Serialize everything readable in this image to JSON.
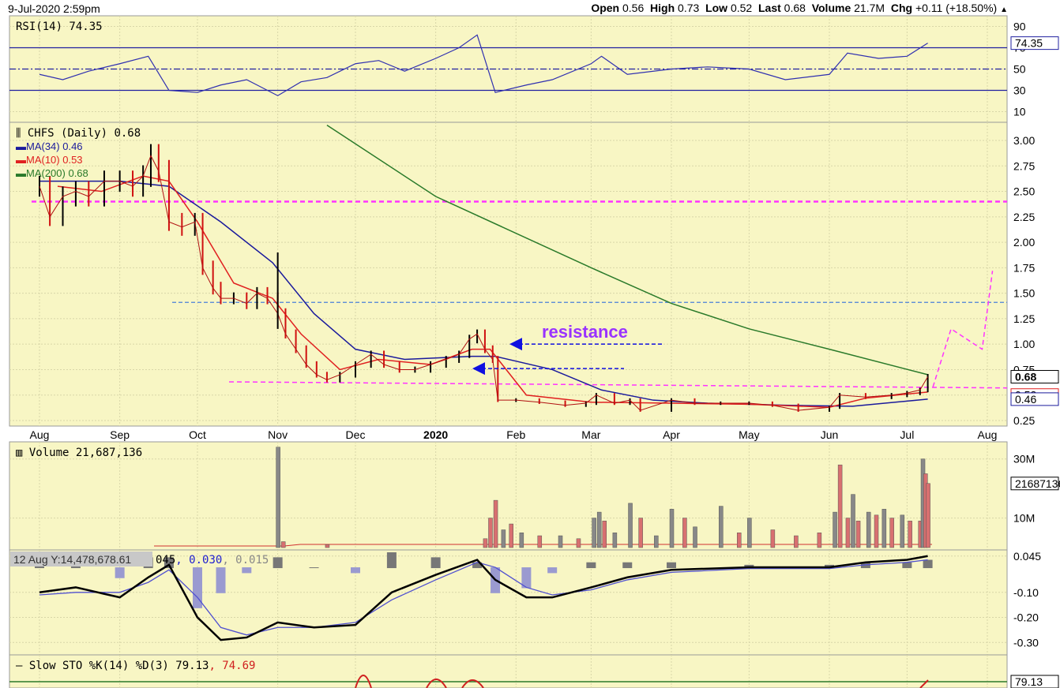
{
  "header": {
    "datetime": "9-Jul-2020 2:59pm",
    "open_label": "Open",
    "open": "0.56",
    "high_label": "High",
    "high": "0.73",
    "low_label": "Low",
    "low": "0.52",
    "last_label": "Last",
    "last": "0.68",
    "volume_label": "Volume",
    "volume": "21.7M",
    "chg_label": "Chg",
    "chg": "+0.11 (+18.50%)",
    "up_icon": "triangle-up-icon"
  },
  "colors": {
    "panel": "#f8f6c4",
    "ma34": "#1a1a9c",
    "ma10": "#e02020",
    "ma200": "#2a7a2a",
    "annot": "#ff33ff",
    "blue_dash": "#4a7fd8",
    "arrow": "#1010e0"
  },
  "chart_data": [
    {
      "type": "line",
      "title": "RSI(14) 74.35",
      "ylim": [
        0,
        100
      ],
      "ticks": [
        "90",
        "70",
        "50",
        "30",
        "10"
      ],
      "tick_values": [
        90,
        70,
        50,
        30,
        10
      ],
      "last_label": "74.35",
      "levels": [
        70,
        50,
        30
      ],
      "x": [
        "2019-08-01",
        "2019-08-10",
        "2019-08-20",
        "2019-09-01",
        "2019-09-12",
        "2019-09-20",
        "2019-10-01",
        "2019-10-10",
        "2019-10-20",
        "2019-11-01",
        "2019-11-10",
        "2019-11-20",
        "2019-12-01",
        "2019-12-10",
        "2019-12-20",
        "2020-01-01",
        "2020-01-10",
        "2020-01-17",
        "2020-01-24",
        "2020-02-05",
        "2020-02-15",
        "2020-03-01",
        "2020-03-05",
        "2020-03-15",
        "2020-04-01",
        "2020-04-15",
        "2020-05-01",
        "2020-05-15",
        "2020-06-01",
        "2020-06-08",
        "2020-06-20",
        "2020-07-01",
        "2020-07-09"
      ],
      "values": [
        45,
        40,
        48,
        55,
        62,
        30,
        28,
        35,
        40,
        25,
        38,
        42,
        55,
        58,
        48,
        60,
        70,
        82,
        28,
        35,
        40,
        55,
        62,
        45,
        50,
        52,
        50,
        40,
        45,
        65,
        60,
        62,
        74.35
      ]
    },
    {
      "type": "ohlc-line",
      "title": "CHFS (Daily) 0.68",
      "ylim": [
        0.25,
        3.0
      ],
      "ticks": [
        "3.00",
        "2.75",
        "2.50",
        "2.25",
        "2.00",
        "1.75",
        "1.50",
        "1.25",
        "1.00",
        "0.75",
        "0.50",
        "0.25"
      ],
      "tick_values": [
        3,
        2.75,
        2.5,
        2.25,
        2,
        1.75,
        1.5,
        1.25,
        1,
        0.75,
        0.5,
        0.25
      ],
      "xticks": [
        "Aug",
        "Sep",
        "Oct",
        "Nov",
        "Dec",
        "2020",
        "Feb",
        "Mar",
        "Apr",
        "May",
        "Jun",
        "Jul",
        "Aug"
      ],
      "xtick_dates": [
        "2019-08-01",
        "2019-09-01",
        "2019-10-01",
        "2019-11-01",
        "2019-12-01",
        "2020-01-01",
        "2020-02-01",
        "2020-03-01",
        "2020-04-01",
        "2020-05-01",
        "2020-06-01",
        "2020-07-01",
        "2020-08-01"
      ],
      "last_labels": {
        "last": "0.68",
        "ma10": "0.53",
        "ma34": "0.46"
      },
      "legend": [
        {
          "name": "MA(34) 0.46",
          "color": "#1a1a9c"
        },
        {
          "name": "MA(10) 0.53",
          "color": "#e02020"
        },
        {
          "name": "MA(200) 0.68",
          "color": "#2a7a2a"
        }
      ],
      "close": {
        "x": [
          "2019-08-01",
          "2019-08-05",
          "2019-08-10",
          "2019-08-15",
          "2019-08-20",
          "2019-08-26",
          "2019-09-01",
          "2019-09-06",
          "2019-09-10",
          "2019-09-13",
          "2019-09-16",
          "2019-09-20",
          "2019-09-25",
          "2019-09-30",
          "2019-10-03",
          "2019-10-07",
          "2019-10-10",
          "2019-10-15",
          "2019-10-20",
          "2019-10-24",
          "2019-10-28",
          "2019-11-01",
          "2019-11-04",
          "2019-11-08",
          "2019-11-12",
          "2019-11-16",
          "2019-11-20",
          "2019-11-25",
          "2019-12-01",
          "2019-12-07",
          "2019-12-12",
          "2019-12-18",
          "2019-12-24",
          "2019-12-30",
          "2020-01-05",
          "2020-01-10",
          "2020-01-14",
          "2020-01-17",
          "2020-01-20",
          "2020-01-23",
          "2020-01-25",
          "2020-02-01",
          "2020-02-10",
          "2020-02-20",
          "2020-02-28",
          "2020-03-03",
          "2020-03-10",
          "2020-03-16",
          "2020-03-20",
          "2020-04-01",
          "2020-04-10",
          "2020-04-20",
          "2020-05-01",
          "2020-05-10",
          "2020-05-20",
          "2020-06-01",
          "2020-06-05",
          "2020-06-15",
          "2020-06-25",
          "2020-07-01",
          "2020-07-06",
          "2020-07-09"
        ],
        "values": [
          2.55,
          2.25,
          2.45,
          2.5,
          2.45,
          2.6,
          2.6,
          2.55,
          2.65,
          2.85,
          2.7,
          2.2,
          2.15,
          2.2,
          1.75,
          1.55,
          1.45,
          1.45,
          1.4,
          1.5,
          1.45,
          1.3,
          1.1,
          0.95,
          0.8,
          0.7,
          0.65,
          0.7,
          0.8,
          0.9,
          0.8,
          0.75,
          0.75,
          0.8,
          0.85,
          0.9,
          1.05,
          1.1,
          0.95,
          0.85,
          0.45,
          0.45,
          0.43,
          0.4,
          0.42,
          0.5,
          0.42,
          0.45,
          0.35,
          0.45,
          0.42,
          0.42,
          0.42,
          0.4,
          0.35,
          0.38,
          0.5,
          0.48,
          0.5,
          0.52,
          0.55,
          0.68
        ]
      },
      "ma34": {
        "x": [
          "2019-08-01",
          "2019-09-01",
          "2019-09-20",
          "2019-10-10",
          "2019-10-30",
          "2019-11-15",
          "2019-12-01",
          "2019-12-20",
          "2020-01-15",
          "2020-01-24",
          "2020-02-15",
          "2020-03-05",
          "2020-03-25",
          "2020-04-15",
          "2020-05-15",
          "2020-06-10",
          "2020-07-09"
        ],
        "values": [
          2.6,
          2.6,
          2.55,
          2.2,
          1.8,
          1.3,
          0.95,
          0.85,
          0.88,
          0.88,
          0.75,
          0.55,
          0.45,
          0.42,
          0.4,
          0.39,
          0.46
        ]
      },
      "ma10": {
        "x": [
          "2019-08-08",
          "2019-08-25",
          "2019-09-10",
          "2019-09-20",
          "2019-10-01",
          "2019-10-15",
          "2019-10-30",
          "2019-11-10",
          "2019-11-25",
          "2019-12-10",
          "2019-12-30",
          "2020-01-15",
          "2020-01-22",
          "2020-02-05",
          "2020-03-01",
          "2020-04-01",
          "2020-05-01",
          "2020-06-01",
          "2020-06-15",
          "2020-07-09"
        ],
        "values": [
          2.55,
          2.5,
          2.65,
          2.6,
          2.2,
          1.6,
          1.45,
          1.1,
          0.75,
          0.85,
          0.8,
          0.95,
          0.95,
          0.5,
          0.43,
          0.42,
          0.41,
          0.38,
          0.47,
          0.53
        ]
      },
      "ma200": {
        "x": [
          "2019-11-20",
          "2020-01-01",
          "2020-03-01",
          "2020-04-01",
          "2020-05-01",
          "2020-06-01",
          "2020-07-09"
        ],
        "values": [
          3.15,
          2.45,
          1.75,
          1.4,
          1.15,
          0.95,
          0.7
        ]
      },
      "annotations": {
        "resistance_text": "resistance",
        "magenta_upper": 2.4,
        "magenta_lower": [
          0.63,
          0.57
        ],
        "blue_dash": 1.41,
        "arrow1_level": 1.0,
        "arrow2_level": 0.76,
        "projection": {
          "x": [
            "2020-07-11",
            "2020-07-18",
            "2020-07-30",
            "2020-08-03"
          ],
          "values": [
            0.58,
            1.15,
            0.95,
            1.72
          ]
        }
      }
    },
    {
      "type": "bar",
      "title": "Volume 21,687,136",
      "ylim": [
        0,
        35
      ],
      "unit": "M",
      "ticks": [
        "30M",
        "10M"
      ],
      "tick_values": [
        30,
        10
      ],
      "last_label": "21687136",
      "x": [
        "2019-11-01",
        "2019-11-03",
        "2019-11-20",
        "2020-01-20",
        "2020-01-22",
        "2020-01-24",
        "2020-01-27",
        "2020-01-30",
        "2020-02-03",
        "2020-02-10",
        "2020-02-18",
        "2020-02-25",
        "2020-03-02",
        "2020-03-04",
        "2020-03-06",
        "2020-03-10",
        "2020-03-16",
        "2020-03-20",
        "2020-03-26",
        "2020-04-01",
        "2020-04-06",
        "2020-04-10",
        "2020-04-20",
        "2020-04-27",
        "2020-05-01",
        "2020-05-10",
        "2020-05-19",
        "2020-05-28",
        "2020-06-03",
        "2020-06-05",
        "2020-06-08",
        "2020-06-10",
        "2020-06-12",
        "2020-06-16",
        "2020-06-19",
        "2020-06-22",
        "2020-06-25",
        "2020-06-29",
        "2020-07-02",
        "2020-07-06",
        "2020-07-07",
        "2020-07-08",
        "2020-07-09"
      ],
      "values": [
        34,
        2,
        1,
        3,
        10,
        16,
        6,
        8,
        5,
        4,
        4,
        3,
        10,
        12,
        9,
        5,
        15,
        10,
        4,
        13,
        10,
        7,
        14,
        5,
        10,
        6,
        4,
        5,
        12,
        28,
        10,
        18,
        9,
        12,
        11,
        13,
        10,
        11,
        9,
        9,
        30,
        25,
        21.7
      ],
      "up": [
        false,
        true,
        true,
        true,
        true,
        true,
        false,
        true,
        false,
        true,
        false,
        true,
        false,
        false,
        true,
        false,
        false,
        true,
        false,
        false,
        true,
        false,
        false,
        true,
        false,
        true,
        true,
        true,
        false,
        true,
        true,
        false,
        true,
        false,
        true,
        false,
        true,
        false,
        true,
        true,
        false,
        true,
        true
      ]
    },
    {
      "type": "line",
      "title": "MACD",
      "values_label_clipped": "045",
      "values_label_a": ", 0.030",
      "values_label_b": ", 0.015",
      "tooltip": "12 Aug Y:14,478,678.61",
      "ylim": [
        -0.34,
        0.06
      ],
      "ticks": [
        "0.045",
        "-0.10",
        "-0.20",
        "-0.30"
      ],
      "tick_values": [
        0.045,
        -0.1,
        -0.2,
        -0.3
      ],
      "x": [
        "2019-08-01",
        "2019-08-15",
        "2019-09-01",
        "2019-09-12",
        "2019-09-20",
        "2019-10-01",
        "2019-10-10",
        "2019-10-20",
        "2019-11-01",
        "2019-11-15",
        "2019-12-01",
        "2019-12-15",
        "2020-01-01",
        "2020-01-17",
        "2020-01-24",
        "2020-02-05",
        "2020-02-15",
        "2020-03-01",
        "2020-03-15",
        "2020-04-01",
        "2020-05-01",
        "2020-06-01",
        "2020-06-15",
        "2020-07-01",
        "2020-07-09"
      ],
      "macd": [
        -0.1,
        -0.08,
        -0.12,
        -0.04,
        0.01,
        -0.2,
        -0.29,
        -0.28,
        -0.22,
        -0.24,
        -0.23,
        -0.1,
        -0.03,
        0.03,
        -0.05,
        -0.12,
        -0.12,
        -0.08,
        -0.04,
        -0.01,
        0.0,
        0.0,
        0.02,
        0.03,
        0.045
      ],
      "signal": [
        -0.11,
        -0.1,
        -0.1,
        -0.06,
        -0.01,
        -0.12,
        -0.24,
        -0.27,
        -0.24,
        -0.24,
        -0.22,
        -0.13,
        -0.05,
        0.02,
        0.0,
        -0.08,
        -0.11,
        -0.09,
        -0.05,
        -0.02,
        -0.005,
        -0.005,
        0.01,
        0.02,
        0.03
      ]
    },
    {
      "type": "line",
      "title": "Slow STO %K(14) %D(3)",
      "k_label": "79.13",
      "d_label": ", 74.69",
      "last_label": "79.13"
    }
  ]
}
